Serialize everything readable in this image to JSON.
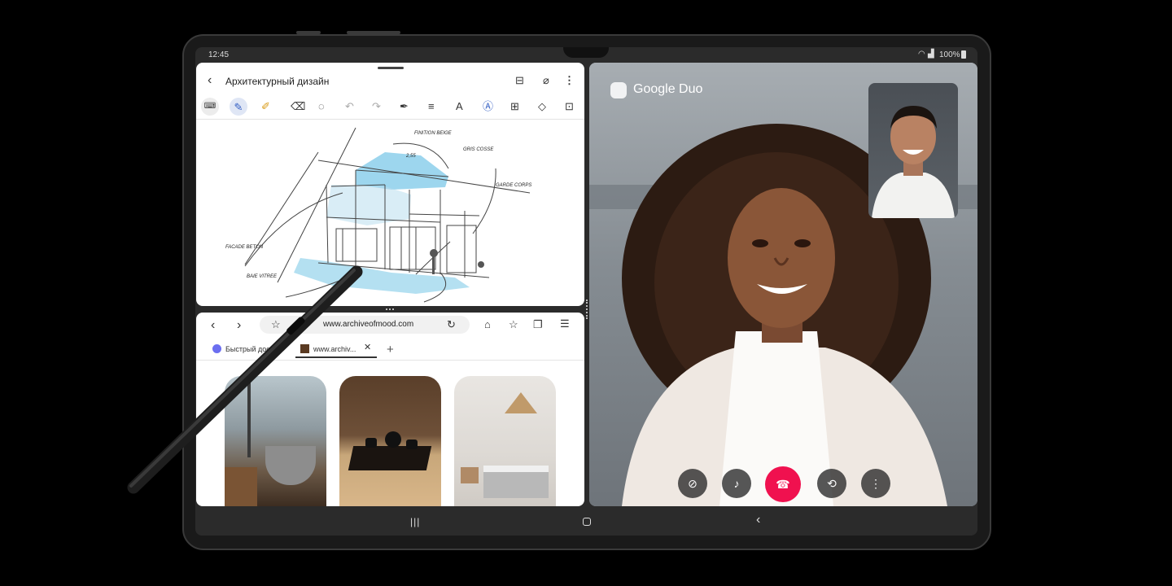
{
  "status": {
    "time": "12:45",
    "battery": "100%"
  },
  "notes": {
    "title": "Архитектурный дизайн",
    "annotations": {
      "a1": "FINITION BEIGE",
      "a2": "GRIS COSSE",
      "a3": "FACADE BETON",
      "a4": "BAIE VITREE",
      "a5": "GARDE CORPS",
      "a6": "2,55"
    }
  },
  "browser": {
    "url": "www.archiveofmood.com",
    "tabs": [
      {
        "label": "Быстрый дос"
      },
      {
        "label": "www.archiv..."
      }
    ]
  },
  "duo": {
    "app_name": "Google Duo"
  },
  "colors": {
    "end_call": "#f0114f",
    "sketch_blue": "#7cc8e8",
    "frame": "#1a1a1a"
  }
}
